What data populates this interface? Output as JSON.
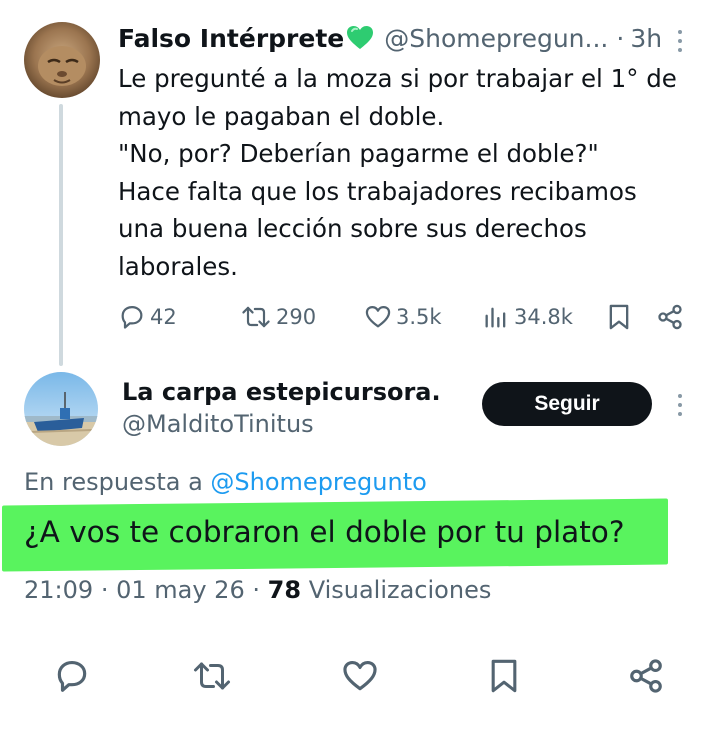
{
  "parent_tweet": {
    "display_name": "Falso Intérprete",
    "handle": "@Shomepregun...",
    "separator": "·",
    "time": "3h",
    "body_lines": [
      "Le pregunté a la moza si por trabajar el 1° de",
      "mayo le pagaban el doble.",
      "\"No, por? Deberían pagarme el doble?\"",
      "Hace falta que los trabajadores recibamos",
      "una buena lección sobre sus derechos",
      "laborales."
    ],
    "metrics": {
      "replies": "42",
      "reposts": "290",
      "likes": "3.5k",
      "views": "34.8k"
    }
  },
  "reply_tweet": {
    "display_name": "La carpa estepicursora.",
    "handle": "@MalditoTinitus",
    "follow_label": "Seguir",
    "in_reply_prefix": "En respuesta a",
    "in_reply_handle": "@Shomepregunto",
    "text": "¿A vos te cobraron el doble por tu plato?",
    "time": "21:09",
    "date": "01 may 26",
    "views_count": "78",
    "views_label": "Visualizaciones",
    "separator": "·"
  },
  "icons": {
    "reply": "reply-icon",
    "repost": "repost-icon",
    "like": "like-icon",
    "views": "views-icon",
    "bookmark": "bookmark-icon",
    "share": "share-icon",
    "more": "more-vertical-icon",
    "badge": "green-heart-icon"
  },
  "colors": {
    "text": "#0f1419",
    "secondary": "#536471",
    "link": "#1d9bf0",
    "highlight": "#59f35e",
    "follow_button": "#0f1419",
    "heart_badge": "#2ecc71"
  }
}
